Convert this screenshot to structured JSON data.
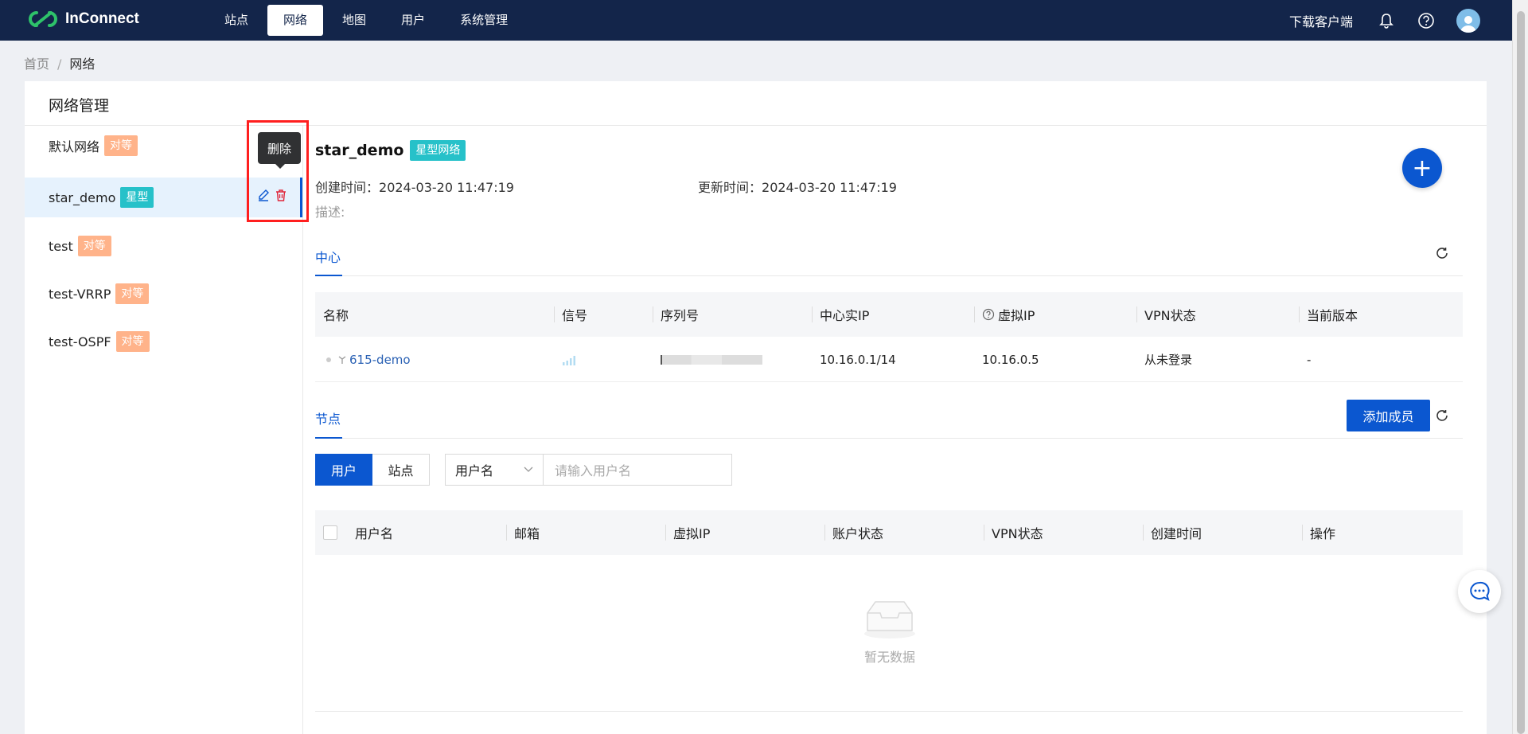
{
  "app": {
    "brand": "InConnect"
  },
  "nav": {
    "items": [
      "站点",
      "网络",
      "地图",
      "用户",
      "系统管理"
    ],
    "active_index": 1
  },
  "header": {
    "download_label": "下载客户端"
  },
  "breadcrumb": {
    "home": "首页",
    "sep": "/",
    "current": "网络"
  },
  "panel": {
    "title": "网络管理"
  },
  "networks": [
    {
      "name": "默认网络",
      "tag": "对等",
      "tag_kind": "peer"
    },
    {
      "name": "star_demo",
      "tag": "星型",
      "tag_kind": "star",
      "selected": true
    },
    {
      "name": "test",
      "tag": "对等",
      "tag_kind": "peer"
    },
    {
      "name": "test-VRRP",
      "tag": "对等",
      "tag_kind": "peer"
    },
    {
      "name": "test-OSPF",
      "tag": "对等",
      "tag_kind": "peer"
    }
  ],
  "tooltip": {
    "text": "删除"
  },
  "detail": {
    "name": "star_demo",
    "tag": "星型网络",
    "created_label": "创建时间：",
    "created_value": "2024-03-20 11:47:19",
    "updated_label": "更新时间：",
    "updated_value": "2024-03-20 11:47:19",
    "desc_label": "描述:"
  },
  "center": {
    "tab": "中心",
    "columns": [
      "名称",
      "信号",
      "序列号",
      "中心实IP",
      "虚拟IP",
      "VPN状态",
      "当前版本"
    ],
    "rows": [
      {
        "name": "615-demo",
        "serial": "",
        "real_ip": "10.16.0.1/14",
        "virtual_ip": "10.16.0.5",
        "vpn": "从未登录",
        "version": "-"
      }
    ]
  },
  "nodes": {
    "tab": "节点",
    "add_button": "添加成员",
    "seg": [
      "用户",
      "站点"
    ],
    "filter_select": "用户名",
    "search_placeholder": "请输入用户名",
    "columns": [
      "用户名",
      "邮箱",
      "虚拟IP",
      "账户状态",
      "VPN状态",
      "创建时间",
      "操作"
    ],
    "empty_text": "暂无数据"
  },
  "colors": {
    "topbar": "#13254a",
    "primary": "#0b57d0",
    "tag_peer": "#ffb38a",
    "tag_star": "#26c1c9",
    "highlight": "#ff1f1f"
  }
}
